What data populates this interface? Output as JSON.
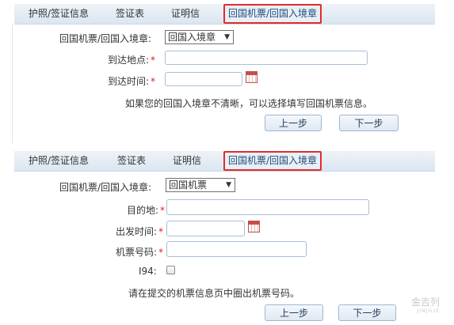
{
  "panel1": {
    "tabs": [
      "护照/签证信息",
      "签证表",
      "证明信",
      "回国机票/回国入境章"
    ],
    "active_tab_index": 3,
    "type_label": "回国机票/回国入境章:",
    "type_select_value": "回国入境章",
    "arrival_place_label": "到达地点:",
    "arrival_time_label": "到达时间:",
    "required_mark": "*",
    "hint": "如果您的回国入境章不清晰，可以选择填写回国机票信息。",
    "prev_button": "上一步",
    "next_button": "下一步"
  },
  "panel2": {
    "tabs": [
      "护照/签证信息",
      "签证表",
      "证明信",
      "回国机票/回国入境章"
    ],
    "active_tab_index": 3,
    "type_label": "回国机票/回国入境章:",
    "type_select_value": "回国机票",
    "destination_label": "目的地:",
    "departure_time_label": "出发时间:",
    "ticket_number_label": "机票号码:",
    "i94_label": "I94:",
    "required_mark": "*",
    "hint": "请在提交的机票信息页中圈出机票号码。",
    "prev_button": "上一步",
    "next_button": "下一步"
  },
  "watermark": {
    "text": "金吉列",
    "subtext": "JINJILIE"
  },
  "colors": {
    "tab_highlight": "#e32b2b",
    "required": "#e02020",
    "accent": "#1f4e79"
  }
}
